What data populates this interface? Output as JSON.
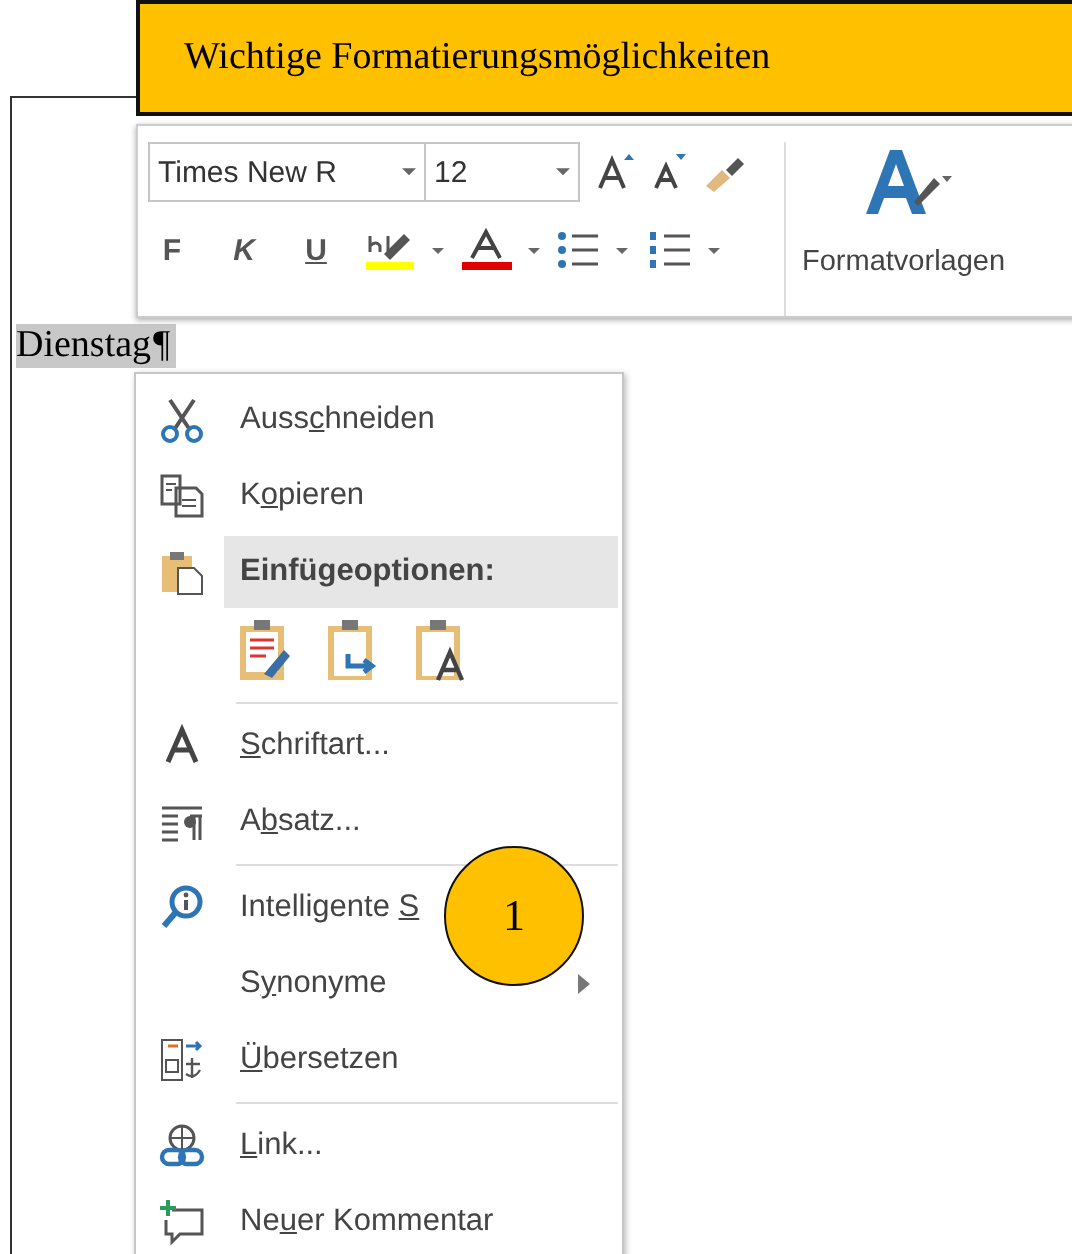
{
  "banner": {
    "title": "Wichtige Formatierungsmöglichkeiten"
  },
  "document": {
    "text": "Dienstag",
    "mark": "¶"
  },
  "mini_toolbar": {
    "font": {
      "value": "Times New R"
    },
    "size": {
      "value": "12"
    },
    "format_buttons": [
      {
        "label": "F",
        "kind": "bold"
      },
      {
        "label": "K",
        "kind": "italic"
      },
      {
        "label": "U",
        "kind": "underline"
      }
    ],
    "styles_label": "Formatvorlagen"
  },
  "context_menu": {
    "items": [
      {
        "kind": "command",
        "pre": "Auss",
        "key": "c",
        "post": "hneiden"
      },
      {
        "kind": "command",
        "pre": "K",
        "key": "o",
        "post": "pieren"
      },
      {
        "kind": "header",
        "pre": "Einfügeoptionen:"
      },
      {
        "kind": "paste_options"
      },
      {
        "kind": "separator"
      },
      {
        "kind": "command",
        "key": "S",
        "post": "chriftart..."
      },
      {
        "kind": "command",
        "pre": "A",
        "key": "b",
        "post": "satz..."
      },
      {
        "kind": "separator"
      },
      {
        "kind": "command",
        "pre": "Intelligente ",
        "key": "S"
      },
      {
        "kind": "submenu",
        "pre": "S",
        "key": "y",
        "post": "nonyme"
      },
      {
        "kind": "command",
        "key": "Ü",
        "post": "bersetzen"
      },
      {
        "kind": "separator"
      },
      {
        "kind": "command",
        "key": "L",
        "post": "ink..."
      },
      {
        "kind": "command",
        "pre": "Ne",
        "key": "u",
        "post": "er Kommentar"
      }
    ]
  },
  "callout": {
    "number": "1"
  }
}
